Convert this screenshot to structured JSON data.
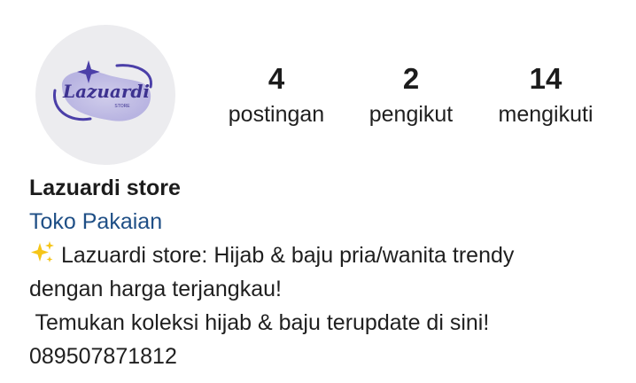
{
  "profile": {
    "avatar_logo_text": "Lazuardi",
    "avatar_logo_subtext": "STORE",
    "name": "Lazuardi store",
    "category": "Toko Pakaian",
    "bio_line1": "Lazuardi store: Hijab & baju pria/wanita trendy",
    "bio_line2": "dengan harga terjangkau!",
    "bio_line3": " Temukan koleksi hijab & baju terupdate di sini!",
    "phone": "089507871812",
    "bio_icon": "sparkles-icon"
  },
  "stats": {
    "posts_count": "4",
    "posts_label": "postingan",
    "followers_count": "2",
    "followers_label": "pengikut",
    "following_count": "14",
    "following_label": "mengikuti"
  },
  "colors": {
    "category_link": "#1f4f86",
    "logo_purple": "#4b3fa8",
    "avatar_bg": "#ececef"
  }
}
